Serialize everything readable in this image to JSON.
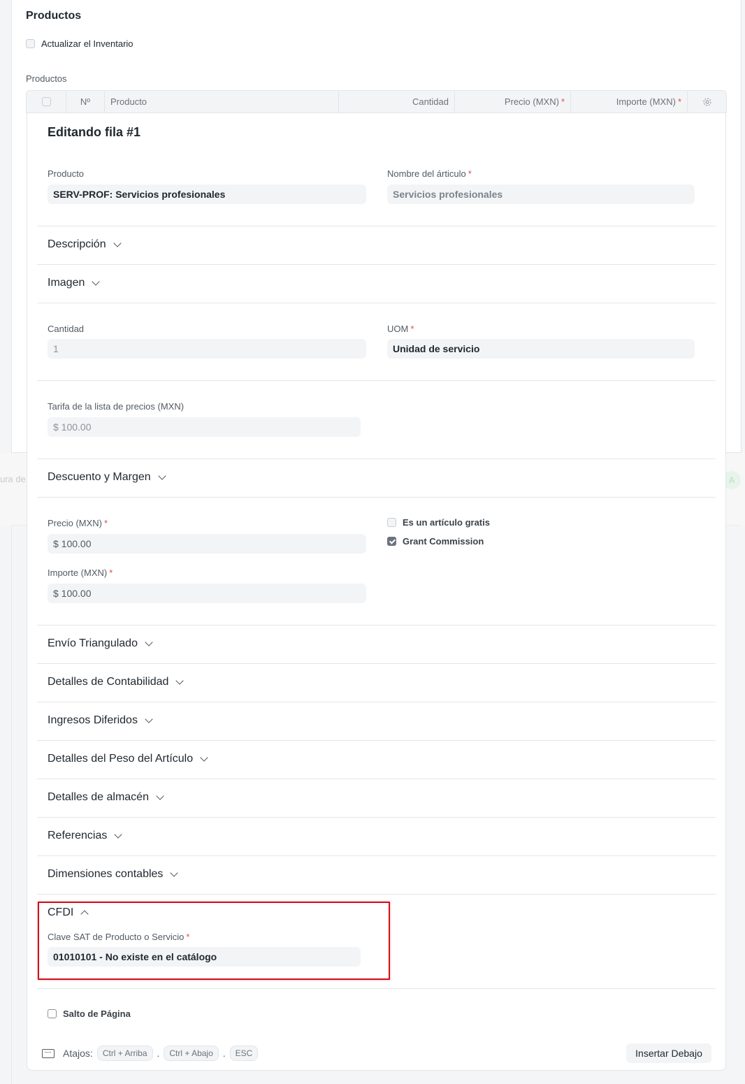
{
  "background": {
    "text": "ura de",
    "avatar_letter": "A"
  },
  "section": {
    "title": "Productos",
    "update_stock_label": "Actualizar el Inventario",
    "table_label": "Productos"
  },
  "grid": {
    "headers": {
      "no": "Nº",
      "item": "Producto",
      "qty": "Cantidad",
      "rate": "Precio (MXN)",
      "amount": "Importe (MXN)"
    }
  },
  "edit": {
    "title": "Editando fila #1",
    "item_code": {
      "label": "Producto",
      "value": "SERV-PROF: Servicios profesionales"
    },
    "item_name": {
      "label": "Nombre del árticulo",
      "value": "Servicios profesionales"
    },
    "sections": {
      "description": "Descripción",
      "image": "Imagen",
      "discount": "Descuento y Margen",
      "drop_ship": "Envío Triangulado",
      "accounting": "Detalles de Contabilidad",
      "deferred": "Ingresos Diferidos",
      "weight": "Detalles del Peso del Artículo",
      "warehouse": "Detalles de almacén",
      "references": "Referencias",
      "dimensions": "Dimensiones contables",
      "cfdi": "CFDI"
    },
    "qty": {
      "label": "Cantidad",
      "value": "1"
    },
    "uom": {
      "label": "UOM",
      "value": "Unidad de servicio"
    },
    "price_list_rate": {
      "label": "Tarifa de la lista de precios (MXN)",
      "value": "$ 100.00"
    },
    "rate": {
      "label": "Precio (MXN)",
      "value": "$ 100.00"
    },
    "amount": {
      "label": "Importe (MXN)",
      "value": "$ 100.00"
    },
    "is_free_item": {
      "label": "Es un artículo gratis",
      "checked": false
    },
    "grant_commission": {
      "label": "Grant Commission",
      "checked": true
    },
    "sat_key": {
      "label": "Clave SAT de Producto o Servicio",
      "value": "01010101 - No existe en el catálogo"
    },
    "page_break": {
      "label": "Salto de Página",
      "checked": false
    }
  },
  "footer": {
    "shortcuts_label": "Atajos:",
    "keys": [
      "Ctrl + Arriba",
      "Ctrl + Abajo",
      "ESC"
    ],
    "separator": ".",
    "insert_below": "Insertar Debajo"
  },
  "colors": {
    "required": "#e24c4c",
    "highlight": "#d10f1b"
  }
}
